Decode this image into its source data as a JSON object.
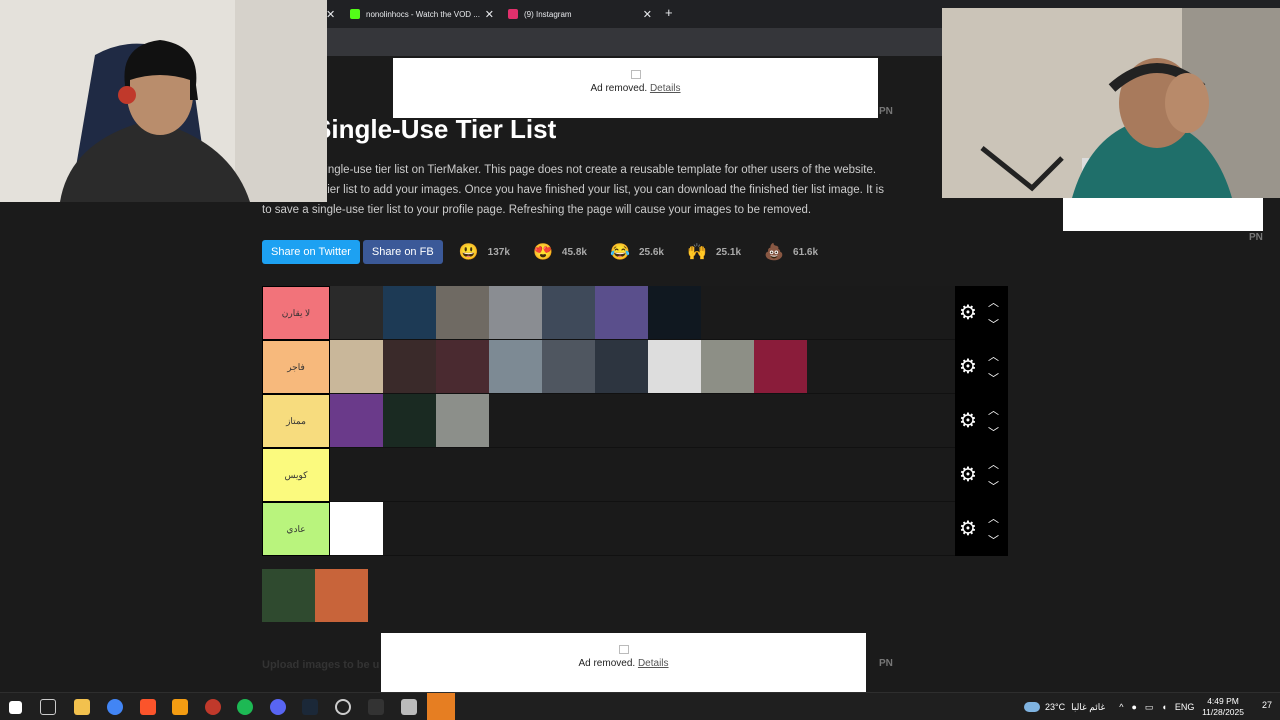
{
  "browser": {
    "tabs": [
      {
        "title": "nonolinhocs - Watch the VOD ...",
        "color": "#53fc18"
      },
      {
        "title": "(9) Instagram",
        "color": "#e1306c"
      }
    ],
    "new_tab": "+"
  },
  "ads": {
    "label": "Ad removed.",
    "details": "Details",
    "pn": "PN"
  },
  "page": {
    "title": "te a Single-Use Tier List",
    "desc_line1": "to create a single-use tier list on TierMaker. This page does not create a reusable template for other users of the website.",
    "desc_line2": "n below the tier list to add your images. Once you have finished your list, you can download the finished tier list image. It is",
    "desc_line3": "to save a single-use tier list to your profile page. Refreshing the page will cause your images to be removed.",
    "upload": "Upload images to be u"
  },
  "share": {
    "twitter": "Share on Twitter",
    "fb": "Share on FB",
    "reactions": [
      {
        "emoji": "😃",
        "count": "137k"
      },
      {
        "emoji": "😍",
        "count": "45.8k"
      },
      {
        "emoji": "😂",
        "count": "25.6k"
      },
      {
        "emoji": "🙌",
        "count": "25.1k"
      },
      {
        "emoji": "💩",
        "count": "61.6k"
      }
    ]
  },
  "tiers": [
    {
      "label": "لا يقارن",
      "color": "#f2737a",
      "items": [
        "#2a2a2a",
        "#1d3a55",
        "#6f6a63",
        "#8a8d92",
        "#3f4a5a",
        "#5a4f8c",
        "#101820"
      ]
    },
    {
      "label": "فاجر",
      "color": "#f7b97c",
      "items": [
        "#c9b79a",
        "#3a2a2a",
        "#4a2a30",
        "#7d8a94",
        "#4f5660",
        "#2d3540",
        "#dddddd",
        "#8d8f86",
        "#8a1c3a"
      ]
    },
    {
      "label": "ممتاز",
      "color": "#f7dc7e",
      "items": [
        "#6a3a8a",
        "#1a2a22",
        "#8c8f8a"
      ]
    },
    {
      "label": "كويس",
      "color": "#fbfa7e",
      "items": []
    },
    {
      "label": "عادي",
      "color": "#b9f47d",
      "items": [
        "#ffffff"
      ]
    }
  ],
  "pool": [
    "#2f4a2f",
    "#c8643a"
  ],
  "taskbar": {
    "weather": "23°C",
    "weather_text": "غائم غالبا",
    "lang": "ENG",
    "time": "4:49 PM",
    "date": "11/28/2025",
    "notif": "27"
  }
}
